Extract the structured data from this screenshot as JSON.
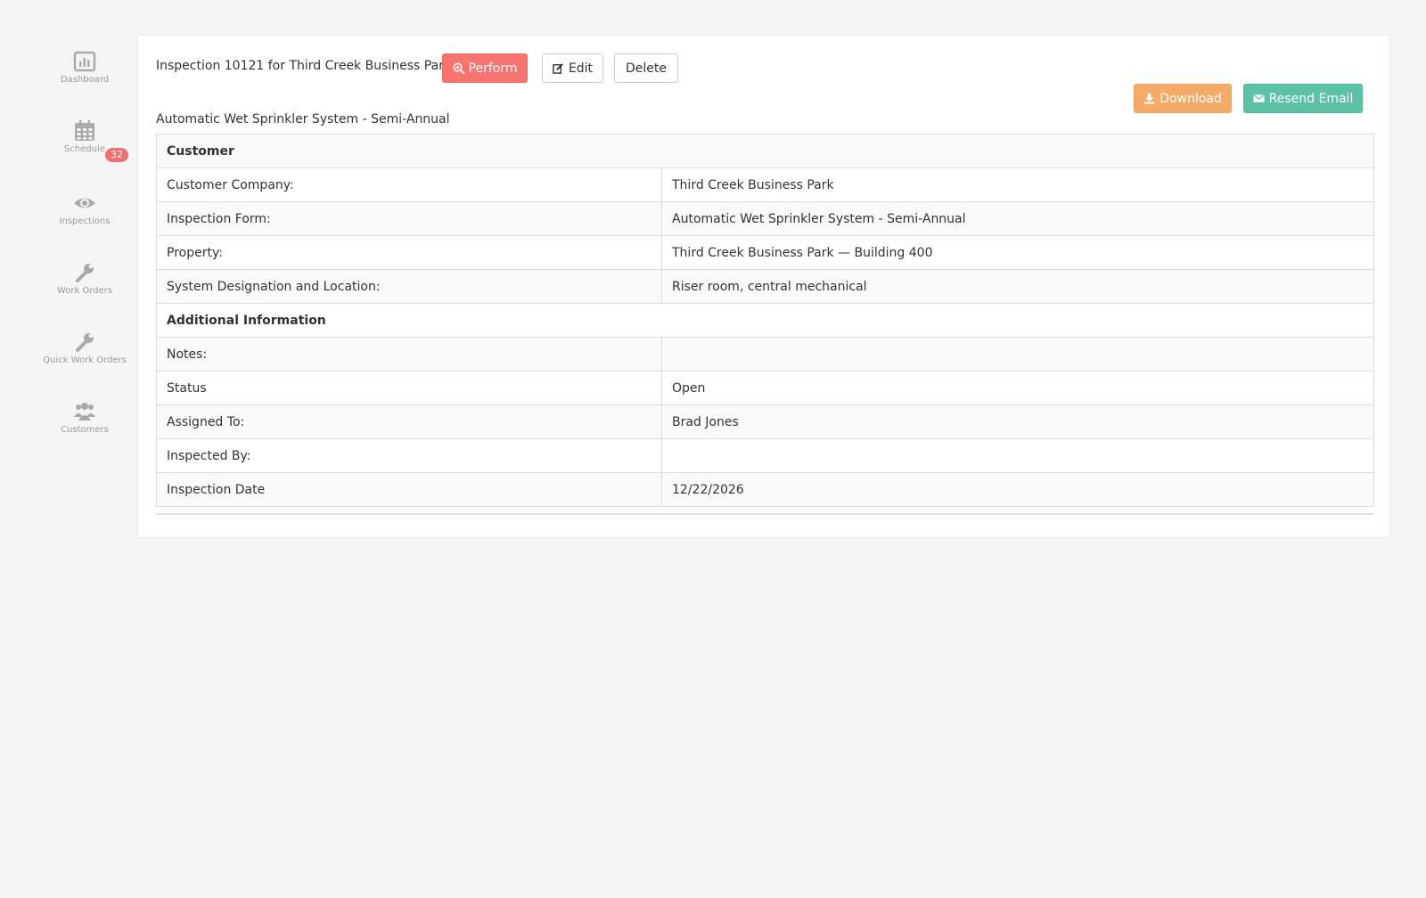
{
  "sidebar": {
    "items": [
      {
        "label": "Dashboard",
        "icon": "bar-chart-icon"
      },
      {
        "label": "Schedule",
        "icon": "calendar-icon",
        "badge": "32"
      },
      {
        "label": "Inspections",
        "icon": "eye-icon"
      },
      {
        "label": "Work Orders",
        "icon": "wrench-icon"
      },
      {
        "label": "Quick Work Orders",
        "icon": "wrench-icon"
      },
      {
        "label": "Customers",
        "icon": "users-icon"
      }
    ]
  },
  "header": {
    "title": "Inspection 10121 for Third Creek Business Park",
    "perform_label": "Perform",
    "edit_label": "Edit",
    "delete_label": "Delete",
    "download_label": "Download",
    "resend_label": "Resend Email",
    "subtitle": "Automatic Wet Sprinkler System - Semi-Annual"
  },
  "table": {
    "customer_section": "Customer",
    "customer_rows": [
      {
        "label": "Customer Company:",
        "value": "Third Creek Business Park"
      },
      {
        "label": "Inspection Form:",
        "value": "Automatic Wet Sprinkler System - Semi-Annual"
      },
      {
        "label": "Property:",
        "value": "Third Creek Business Park — Building 400"
      },
      {
        "label": "System Designation and Location:",
        "value": "Riser room, central mechanical"
      }
    ],
    "additional_section": "Additional Information",
    "additional_rows": [
      {
        "label": "Notes:",
        "value": ""
      },
      {
        "label": "Status",
        "value": "Open"
      },
      {
        "label": "Assigned To:",
        "value": "Brad Jones"
      },
      {
        "label": "Inspected By:",
        "value": ""
      },
      {
        "label": "Inspection Date",
        "value": "12/22/2026"
      }
    ]
  },
  "colors": {
    "background": "#f5f5f5",
    "perform": "#f97371",
    "download": "#f5ab68",
    "resend": "#5dc2a5",
    "badge": "#f0706e",
    "sidebar_icon": "#aaaaaa"
  }
}
